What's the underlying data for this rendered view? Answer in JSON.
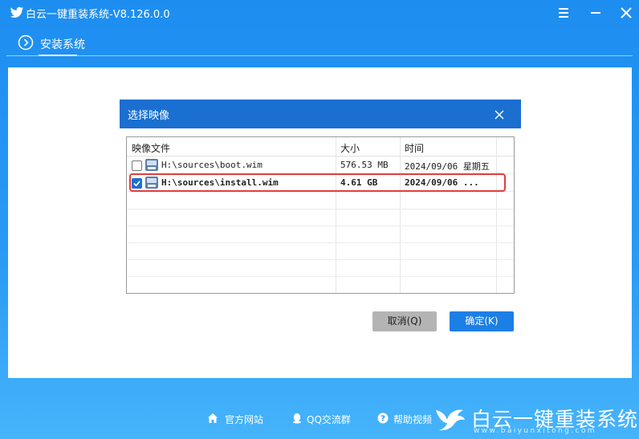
{
  "app": {
    "title": "白云一键重装系统-V8.126.0.0",
    "logo_icon": "bird-icon"
  },
  "window_controls": [
    "menu-icon",
    "minimize-icon",
    "close-icon"
  ],
  "nav": {
    "tab_label": "安装系统",
    "tab_icon": "chevron-right-circle-icon"
  },
  "dialog": {
    "title": "选择映像",
    "columns": [
      "映像文件",
      "大小",
      "时间"
    ],
    "rows": [
      {
        "checked": false,
        "name": "H:\\sources\\boot.wim",
        "size": "576.53 MB",
        "time": "2024/09/06 星期五"
      },
      {
        "checked": true,
        "name": "H:\\sources\\install.wim",
        "size": "4.61 GB",
        "time": "2024/09/06 ..."
      }
    ],
    "cancel_label": "取消(Q)",
    "ok_label": "确定(K)"
  },
  "footer": {
    "links": [
      {
        "label": "官方网站",
        "icon": "home-icon"
      },
      {
        "label": "QQ交流群",
        "icon": "qq-penguin-icon"
      },
      {
        "label": "帮助视频",
        "icon": "help-icon"
      }
    ]
  },
  "brand": {
    "name": "白云一键重装系统",
    "url": "www.baiyunxitong.com"
  },
  "colors": {
    "background": "#2a9af5",
    "dialog_header": "#1a6fd1",
    "ok_button": "#1c7fe6",
    "highlight": "#e43c3c"
  }
}
